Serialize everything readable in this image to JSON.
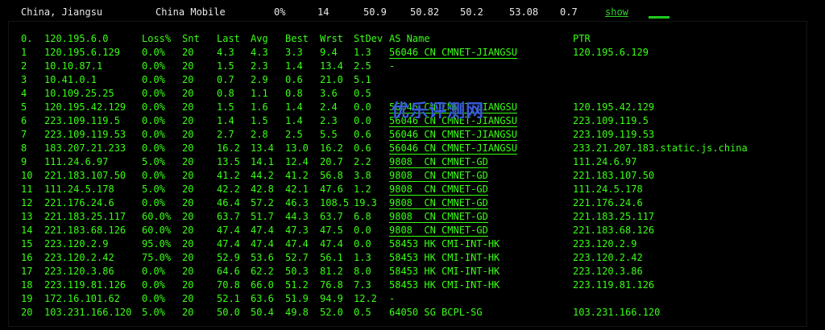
{
  "summary": {
    "location": "China, Jiangsu",
    "isp": "China Mobile",
    "loss": "0%",
    "sent": "14",
    "last": "50.9",
    "avg": "50.82",
    "best": "50.2",
    "worst": "53.08",
    "stdev": "0.7",
    "show_link": "show"
  },
  "table": {
    "headers": {
      "num": "0.",
      "ip": "120.195.6.0",
      "loss": "Loss%",
      "snt": "Snt",
      "last": "Last",
      "avg": "Avg",
      "best": "Best",
      "wrst": "Wrst",
      "stdev": "StDev",
      "as": "AS Name",
      "ptr": "PTR"
    },
    "rows": [
      {
        "num": "1",
        "ip": "120.195.6.129",
        "loss": "0.0%",
        "snt": "20",
        "last": "4.3",
        "avg": "4.3",
        "best": "3.3",
        "wrst": "9.4",
        "stdev": "1.3",
        "as": "56046 CN CMNET-JIANGSU",
        "ptr": "120.195.6.129"
      },
      {
        "num": "2",
        "ip": "10.10.87.1",
        "loss": "0.0%",
        "snt": "20",
        "last": "1.5",
        "avg": "2.3",
        "best": "1.4",
        "wrst": "13.4",
        "stdev": "2.5",
        "as": "-",
        "ptr": ""
      },
      {
        "num": "3",
        "ip": "10.41.0.1",
        "loss": "0.0%",
        "snt": "20",
        "last": "0.7",
        "avg": "2.9",
        "best": "0.6",
        "wrst": "21.0",
        "stdev": "5.1",
        "as": "",
        "ptr": ""
      },
      {
        "num": "4",
        "ip": "10.109.25.25",
        "loss": "0.0%",
        "snt": "20",
        "last": "0.8",
        "avg": "1.1",
        "best": "0.8",
        "wrst": "3.6",
        "stdev": "0.5",
        "as": "",
        "ptr": ""
      },
      {
        "num": "5",
        "ip": "120.195.42.129",
        "loss": "0.0%",
        "snt": "20",
        "last": "1.5",
        "avg": "1.6",
        "best": "1.4",
        "wrst": "2.4",
        "stdev": "0.0",
        "as": "56046 CN CMNET-JIANGSU",
        "ptr": "120.195.42.129"
      },
      {
        "num": "6",
        "ip": "223.109.119.5",
        "loss": "0.0%",
        "snt": "20",
        "last": "1.4",
        "avg": "1.5",
        "best": "1.4",
        "wrst": "2.3",
        "stdev": "0.0",
        "as": "56046 CN CMNET-JIANGSU",
        "ptr": "223.109.119.5"
      },
      {
        "num": "7",
        "ip": "223.109.119.53",
        "loss": "0.0%",
        "snt": "20",
        "last": "2.7",
        "avg": "2.8",
        "best": "2.5",
        "wrst": "5.5",
        "stdev": "0.6",
        "as": "56046 CN CMNET-JIANGSU",
        "ptr": "223.109.119.53"
      },
      {
        "num": "8",
        "ip": "183.207.21.233",
        "loss": "0.0%",
        "snt": "20",
        "last": "16.2",
        "avg": "13.4",
        "best": "13.0",
        "wrst": "16.2",
        "stdev": "0.6",
        "as": "56046 CN CMNET-JIANGSU",
        "ptr": "233.21.207.183.static.js.china"
      },
      {
        "num": "9",
        "ip": "111.24.6.97",
        "loss": "5.0%",
        "snt": "20",
        "last": "13.5",
        "avg": "14.1",
        "best": "12.4",
        "wrst": "20.7",
        "stdev": "2.2",
        "as": "9808  CN CMNET-GD",
        "ptr": "111.24.6.97"
      },
      {
        "num": "10",
        "ip": "221.183.107.50",
        "loss": "0.0%",
        "snt": "20",
        "last": "41.2",
        "avg": "44.2",
        "best": "41.2",
        "wrst": "56.8",
        "stdev": "3.8",
        "as": "9808  CN CMNET-GD",
        "ptr": "221.183.107.50"
      },
      {
        "num": "11",
        "ip": "111.24.5.178",
        "loss": "5.0%",
        "snt": "20",
        "last": "42.2",
        "avg": "42.8",
        "best": "42.1",
        "wrst": "47.6",
        "stdev": "1.2",
        "as": "9808  CN CMNET-GD",
        "ptr": "111.24.5.178"
      },
      {
        "num": "12",
        "ip": "221.176.24.6",
        "loss": "0.0%",
        "snt": "20",
        "last": "46.4",
        "avg": "57.2",
        "best": "46.3",
        "wrst": "108.5",
        "stdev": "19.3",
        "as": "9808  CN CMNET-GD",
        "ptr": "221.176.24.6"
      },
      {
        "num": "13",
        "ip": "221.183.25.117",
        "loss": "60.0%",
        "snt": "20",
        "last": "63.7",
        "avg": "51.7",
        "best": "44.3",
        "wrst": "63.7",
        "stdev": "6.8",
        "as": "9808  CN CMNET-GD",
        "ptr": "221.183.25.117"
      },
      {
        "num": "14",
        "ip": "221.183.68.126",
        "loss": "60.0%",
        "snt": "20",
        "last": "47.4",
        "avg": "47.4",
        "best": "47.3",
        "wrst": "47.5",
        "stdev": "0.0",
        "as": "9808  CN CMNET-GD",
        "ptr": "221.183.68.126"
      },
      {
        "num": "15",
        "ip": "223.120.2.9",
        "loss": "95.0%",
        "snt": "20",
        "last": "47.4",
        "avg": "47.4",
        "best": "47.4",
        "wrst": "47.4",
        "stdev": "0.0",
        "as": "58453 HK CMI-INT-HK",
        "ptr": "223.120.2.9"
      },
      {
        "num": "16",
        "ip": "223.120.2.42",
        "loss": "75.0%",
        "snt": "20",
        "last": "52.9",
        "avg": "53.6",
        "best": "52.7",
        "wrst": "56.1",
        "stdev": "1.3",
        "as": "58453 HK CMI-INT-HK",
        "ptr": "223.120.2.42"
      },
      {
        "num": "17",
        "ip": "223.120.3.86",
        "loss": "0.0%",
        "snt": "20",
        "last": "64.6",
        "avg": "62.2",
        "best": "50.3",
        "wrst": "81.2",
        "stdev": "8.0",
        "as": "58453 HK CMI-INT-HK",
        "ptr": "223.120.3.86"
      },
      {
        "num": "18",
        "ip": "223.119.81.126",
        "loss": "0.0%",
        "snt": "20",
        "last": "70.8",
        "avg": "66.0",
        "best": "51.2",
        "wrst": "76.8",
        "stdev": "7.3",
        "as": "58453 HK CMI-INT-HK",
        "ptr": "223.119.81.126"
      },
      {
        "num": "19",
        "ip": "172.16.101.62",
        "loss": "0.0%",
        "snt": "20",
        "last": "52.1",
        "avg": "63.6",
        "best": "51.9",
        "wrst": "94.9",
        "stdev": "12.2",
        "as": "-",
        "ptr": ""
      },
      {
        "num": "20",
        "ip": "103.231.166.120",
        "loss": "5.0%",
        "snt": "20",
        "last": "50.0",
        "avg": "50.4",
        "best": "49.8",
        "wrst": "52.0",
        "stdev": "0.5",
        "as": "64050 SG BCPL-SG",
        "ptr": "103.231.166.120"
      }
    ]
  },
  "watermark": "优乐评测网",
  "colors": {
    "background": "#000000",
    "terminal_text": "#39ff14",
    "summary_text": "#e8e8e8",
    "link": "#2ed12e",
    "watermark": "#3a5bdc"
  }
}
